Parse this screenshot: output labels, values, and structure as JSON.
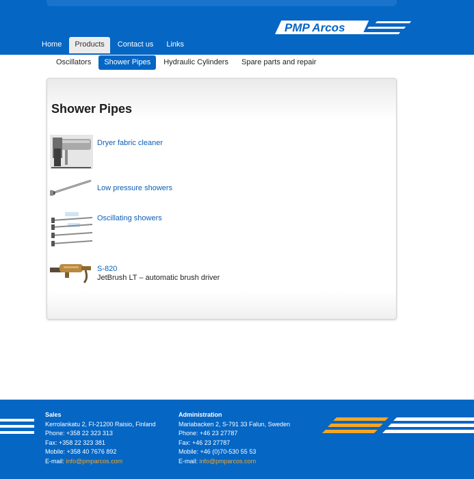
{
  "logo": {
    "text": "PMP Arcos"
  },
  "main_nav": [
    {
      "label": "Home",
      "active": false
    },
    {
      "label": "Products",
      "active": true
    },
    {
      "label": "Contact us",
      "active": false
    },
    {
      "label": "Links",
      "active": false
    }
  ],
  "sub_nav": [
    {
      "label": "Oscillators",
      "active": false
    },
    {
      "label": "Shower Pipes",
      "active": true
    },
    {
      "label": "Hydraulic Cylinders",
      "active": false
    },
    {
      "label": "Spare parts and repair",
      "active": false
    }
  ],
  "content": {
    "title": "Shower Pipes",
    "entries": [
      {
        "link": "Dryer fabric cleaner",
        "desc": ""
      },
      {
        "link": "Low pressure showers",
        "desc": ""
      },
      {
        "link": "Oscillating showers",
        "desc": ""
      },
      {
        "link": "S-820",
        "desc": "JetBrush LT – automatic brush driver"
      }
    ]
  },
  "footer": {
    "sales": {
      "heading": "Sales",
      "address": "Kerrolankatu 2, FI-21200 Raisio, Finland",
      "phone": "Phone: +358 22 323 313",
      "fax": "Fax: +358 22 323 381",
      "mobile": "Mobile: +358 40 7676 892",
      "email_label": "E-mail: ",
      "email": "info@pmparcos.com"
    },
    "administration": {
      "heading": "Administration",
      "address": "Mariabacken 2, S-791 33 Falun, Sweden",
      "phone": "Phone: +46 23 27787",
      "fax": "Fax: +46 23 27787",
      "mobile": "Mobile: +46 (0)70-530 55 53",
      "email_label": "E-mail: ",
      "email": "info@pmparcos.com"
    }
  },
  "colors": {
    "brand_blue": "#0566c4",
    "accent_orange": "#f5a623",
    "link_blue": "#0a5fb4"
  }
}
